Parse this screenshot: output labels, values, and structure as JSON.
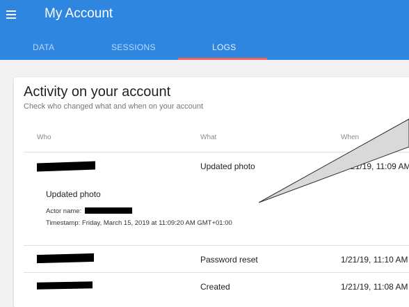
{
  "app": {
    "title": "My Account"
  },
  "tabs": [
    {
      "label": "DATA",
      "active": false
    },
    {
      "label": "SESSIONS",
      "active": false
    },
    {
      "label": "LOGS",
      "active": true
    }
  ],
  "colors": {
    "appbar": "#2e86e0",
    "tab_indicator": "#f1655a"
  },
  "activity": {
    "title": "Activity on your account",
    "subtitle": "Check who changed what and when on your account",
    "columns": {
      "who": "Who",
      "what": "What",
      "when": "When"
    },
    "rows": [
      {
        "what": "Updated photo",
        "when": "1/21/19, 11:09 AM"
      },
      {
        "what": "Password reset",
        "when": "1/21/19, 11:10 AM"
      },
      {
        "what": "Created",
        "when": "1/21/19, 11:08 AM"
      }
    ],
    "detail": {
      "title": "Updated photo",
      "actor_label": "Actor name:",
      "timestamp": "Timestamp: Friday, March 15, 2019 at 11:09:20 AM GMT+01:00"
    }
  }
}
